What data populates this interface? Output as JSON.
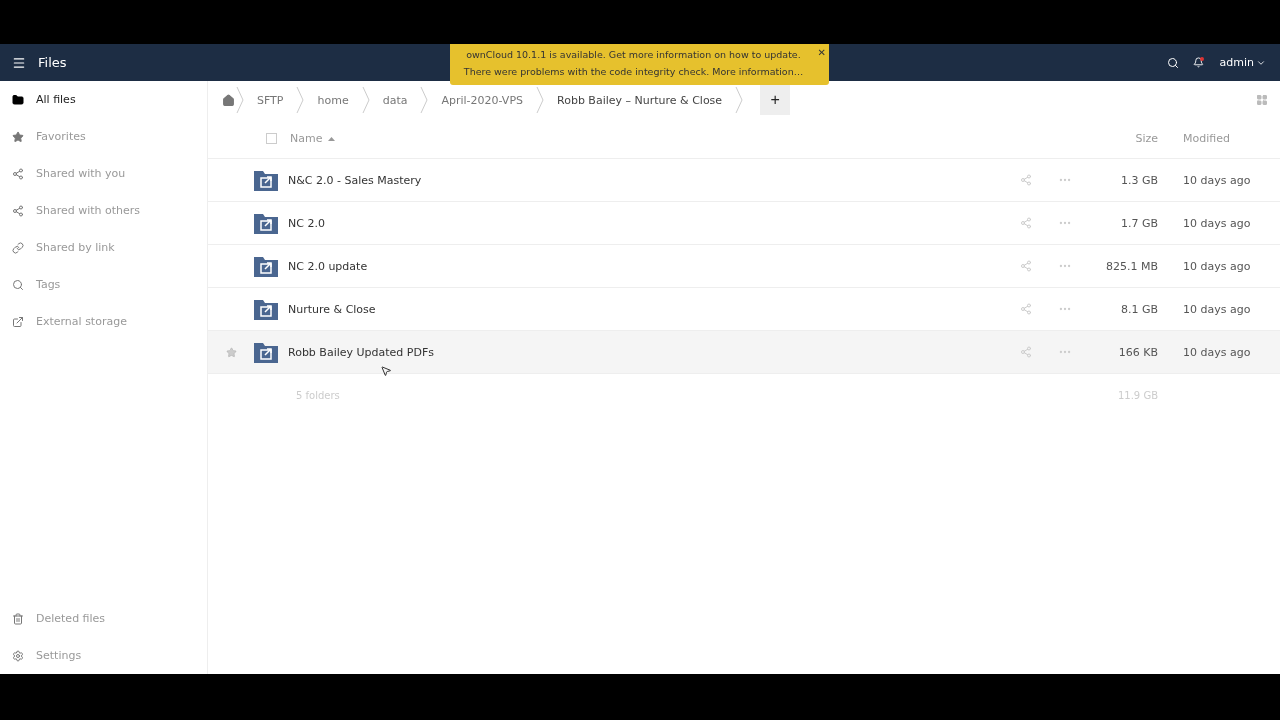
{
  "header": {
    "title": "Files",
    "user": "admin"
  },
  "notification": {
    "lines": [
      "ownCloud 10.1.1 is available. Get more information on how to update.",
      "There were problems with the code integrity check. More information…"
    ],
    "close": "✕"
  },
  "sidebar": {
    "items": [
      {
        "kind": "folder",
        "label": "All files",
        "selected": true
      },
      {
        "kind": "star",
        "label": "Favorites",
        "selected": false
      },
      {
        "kind": "share",
        "label": "Shared with you",
        "selected": false
      },
      {
        "kind": "share",
        "label": "Shared with others",
        "selected": false
      },
      {
        "kind": "link",
        "label": "Shared by link",
        "selected": false
      },
      {
        "kind": "search",
        "label": "Tags",
        "selected": false
      },
      {
        "kind": "external",
        "label": "External storage",
        "selected": false
      }
    ],
    "bottom": [
      {
        "kind": "trash",
        "label": "Deleted files"
      },
      {
        "kind": "gear",
        "label": "Settings"
      }
    ]
  },
  "breadcrumbs": [
    "SFTP",
    "home",
    "data",
    "April-2020-VPS",
    "Robb Bailey – Nurture & Close"
  ],
  "add_button": "+",
  "table": {
    "select_all": {
      "checked": false
    },
    "columns": [
      "Name",
      "Size",
      "Modified"
    ],
    "rows": [
      {
        "name": "N&C 2.0 - Sales Mastery",
        "size": "1.3 GB",
        "modified": "10 days ago",
        "hovered": false
      },
      {
        "name": "NC 2.0",
        "size": "1.7 GB",
        "modified": "10 days ago",
        "hovered": false
      },
      {
        "name": "NC 2.0 update",
        "size": "825.1 MB",
        "modified": "10 days ago",
        "hovered": false
      },
      {
        "name": "Nurture & Close",
        "size": "8.1 GB",
        "modified": "10 days ago",
        "hovered": false
      },
      {
        "name": "Robb Bailey Updated PDFs",
        "size": "166 KB",
        "modified": "10 days ago",
        "hovered": true
      }
    ],
    "summary": {
      "count": "5 folders",
      "size": "11.9 GB"
    }
  }
}
